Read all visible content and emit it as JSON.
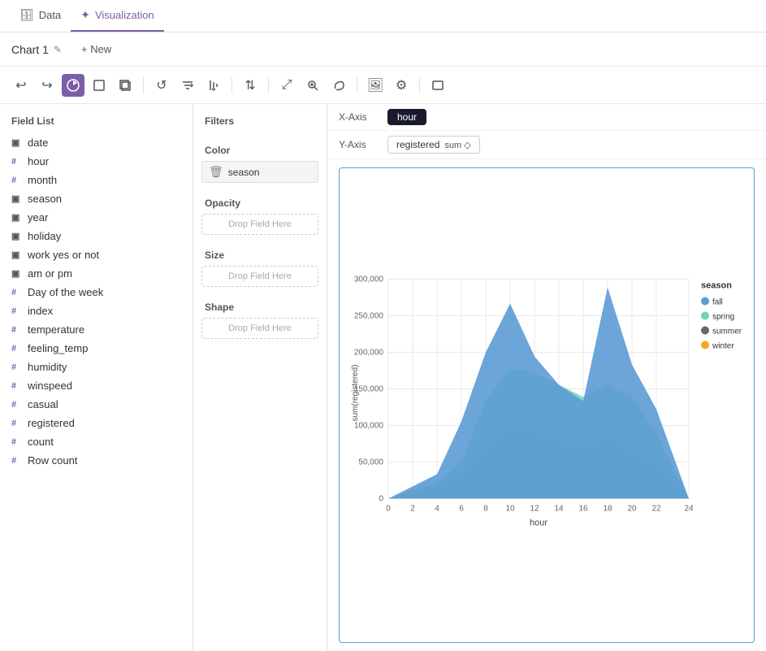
{
  "tabs": [
    {
      "id": "data",
      "label": "Data",
      "icon": "🗄",
      "active": false
    },
    {
      "id": "visualization",
      "label": "Visualization",
      "icon": "✦",
      "active": true
    }
  ],
  "chartTitle": "Chart 1",
  "newButton": "+ New",
  "toolbar": {
    "buttons": [
      {
        "id": "undo",
        "icon": "↩",
        "label": "Undo",
        "active": false
      },
      {
        "id": "redo",
        "icon": "↪",
        "label": "Redo",
        "active": false
      },
      {
        "id": "chart-type",
        "icon": "◉",
        "label": "Chart type",
        "active": true
      },
      {
        "id": "mark-type",
        "icon": "⬚",
        "label": "Mark type",
        "active": false
      },
      {
        "id": "layers",
        "icon": "⧉",
        "label": "Layers",
        "active": false
      },
      {
        "id": "refresh",
        "icon": "↺",
        "label": "Refresh",
        "active": false
      },
      {
        "id": "filter-row",
        "icon": "≡↓",
        "label": "Filter rows",
        "active": false
      },
      {
        "id": "filter-col",
        "icon": "⫼↓",
        "label": "Filter columns",
        "active": false
      },
      {
        "id": "sort",
        "icon": "⇅",
        "label": "Sort",
        "active": false
      },
      {
        "id": "zoom-fit",
        "icon": "⤢",
        "label": "Zoom to fit",
        "active": false
      },
      {
        "id": "zoom-custom",
        "icon": "⊞",
        "label": "Custom zoom",
        "active": false
      },
      {
        "id": "lasso",
        "icon": "⌒",
        "label": "Lasso",
        "active": false
      },
      {
        "id": "image",
        "icon": "🖼",
        "label": "Image",
        "active": false
      },
      {
        "id": "settings",
        "icon": "⚙",
        "label": "Settings",
        "active": false
      },
      {
        "id": "embed",
        "icon": "⬜",
        "label": "Embed",
        "active": false
      }
    ]
  },
  "fieldList": {
    "header": "Field List",
    "fields": [
      {
        "name": "date",
        "type": "date"
      },
      {
        "name": "hour",
        "type": "numeric"
      },
      {
        "name": "month",
        "type": "numeric"
      },
      {
        "name": "season",
        "type": "string"
      },
      {
        "name": "year",
        "type": "string"
      },
      {
        "name": "holiday",
        "type": "string"
      },
      {
        "name": "work yes or not",
        "type": "string"
      },
      {
        "name": "am or pm",
        "type": "string"
      },
      {
        "name": "Day of the week",
        "type": "numeric"
      },
      {
        "name": "index",
        "type": "numeric"
      },
      {
        "name": "temperature",
        "type": "numeric"
      },
      {
        "name": "feeling_temp",
        "type": "numeric"
      },
      {
        "name": "humidity",
        "type": "numeric"
      },
      {
        "name": "winspeed",
        "type": "numeric"
      },
      {
        "name": "casual",
        "type": "numeric"
      },
      {
        "name": "registered",
        "type": "numeric"
      },
      {
        "name": "count",
        "type": "numeric"
      },
      {
        "name": "Row count",
        "type": "numeric"
      }
    ]
  },
  "filters": {
    "header": "Filters"
  },
  "colorSection": {
    "label": "Color",
    "value": "season"
  },
  "opacitySection": {
    "label": "Opacity",
    "dropLabel": "Drop Field Here"
  },
  "sizeSection": {
    "label": "Size",
    "dropLabel": "Drop Field Here"
  },
  "shapeSection": {
    "label": "Shape",
    "dropLabel": "Drop Field Here"
  },
  "axes": {
    "xLabel": "X-Axis",
    "xValue": "hour",
    "yLabel": "Y-Axis",
    "yField": "registered",
    "yAgg": "sum ◇"
  },
  "chart": {
    "xAxisLabel": "hour",
    "yAxisLabel": "sum(registered)",
    "legend": {
      "title": "season",
      "items": [
        {
          "label": "fall",
          "color": "#5b9bd5"
        },
        {
          "label": "spring",
          "color": "#70d4b4"
        },
        {
          "label": "summer",
          "color": "#666"
        },
        {
          "label": "winter",
          "color": "#f5a623"
        }
      ]
    },
    "xTicks": [
      "0",
      "2",
      "4",
      "6",
      "8",
      "10",
      "12",
      "14",
      "16",
      "18",
      "20",
      "22",
      "24"
    ],
    "yTicks": [
      "0",
      "50,000",
      "100,000",
      "150,000",
      "200,000",
      "250,000",
      "300,000"
    ]
  }
}
